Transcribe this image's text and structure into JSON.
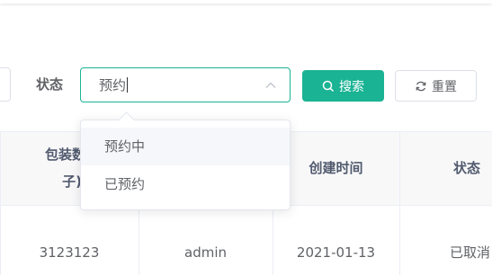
{
  "filter": {
    "status_label": "状态",
    "status_input_value": "预约",
    "status_options": [
      "预约中",
      "已预约"
    ],
    "search_label": "搜索",
    "reset_label": "重置"
  },
  "table": {
    "headers": [
      "包装数量",
      "子)",
      "创建时间",
      "状态"
    ],
    "row": [
      "3123123",
      "admin",
      "2021-01-13",
      "已取消"
    ]
  },
  "colors": {
    "accent": "#1ab394"
  }
}
